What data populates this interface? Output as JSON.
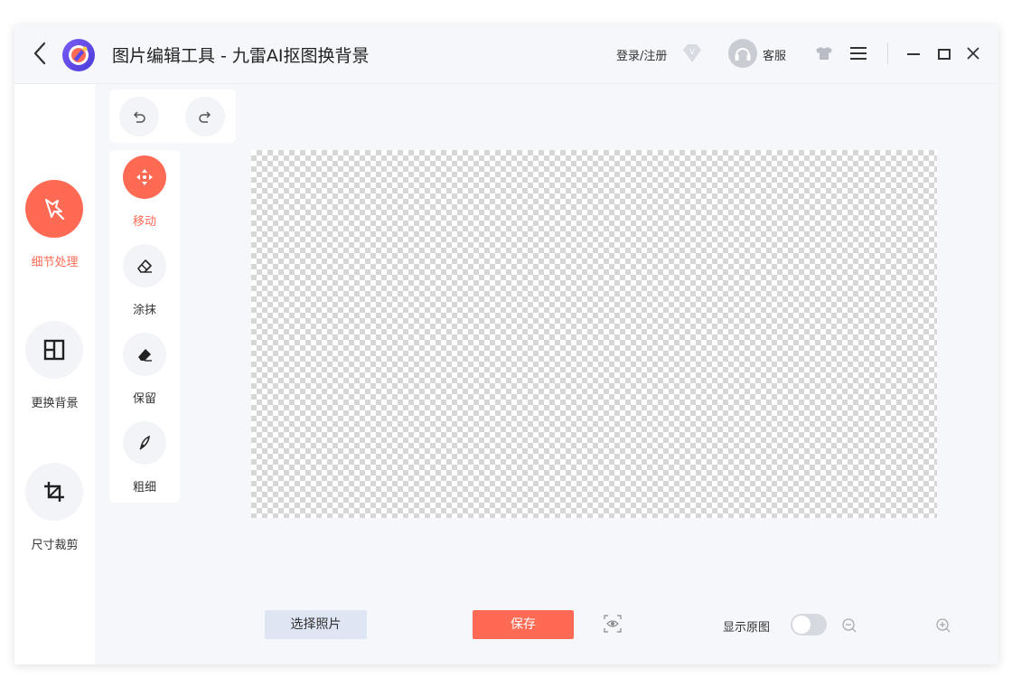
{
  "titlebar": {
    "title": "图片编辑工具 - 九雷AI抠图换背景",
    "login_label": "登录/注册",
    "service_label": "客服"
  },
  "sidebar": {
    "items": [
      {
        "label": "细节处理",
        "icon": "magic-wand-icon",
        "active": true
      },
      {
        "label": "更换背景",
        "icon": "layout-icon",
        "active": false
      },
      {
        "label": "尺寸裁剪",
        "icon": "crop-icon",
        "active": false
      }
    ]
  },
  "history": {
    "undo_icon": "undo-icon",
    "redo_icon": "redo-icon"
  },
  "tools": {
    "items": [
      {
        "label": "移动",
        "icon": "move-icon",
        "active": true
      },
      {
        "label": "涂抹",
        "icon": "eraser-icon",
        "active": false
      },
      {
        "label": "保留",
        "icon": "keep-brush-icon",
        "active": false
      },
      {
        "label": "粗细",
        "icon": "brush-size-icon",
        "active": false
      }
    ]
  },
  "bottombar": {
    "choose_label": "选择照片",
    "save_label": "保存",
    "show_original_label": "显示原图",
    "show_original_on": false
  },
  "colors": {
    "accent": "#ff6a55",
    "panel_bg": "#f5f7fa",
    "checker": "#d6d6d6"
  }
}
